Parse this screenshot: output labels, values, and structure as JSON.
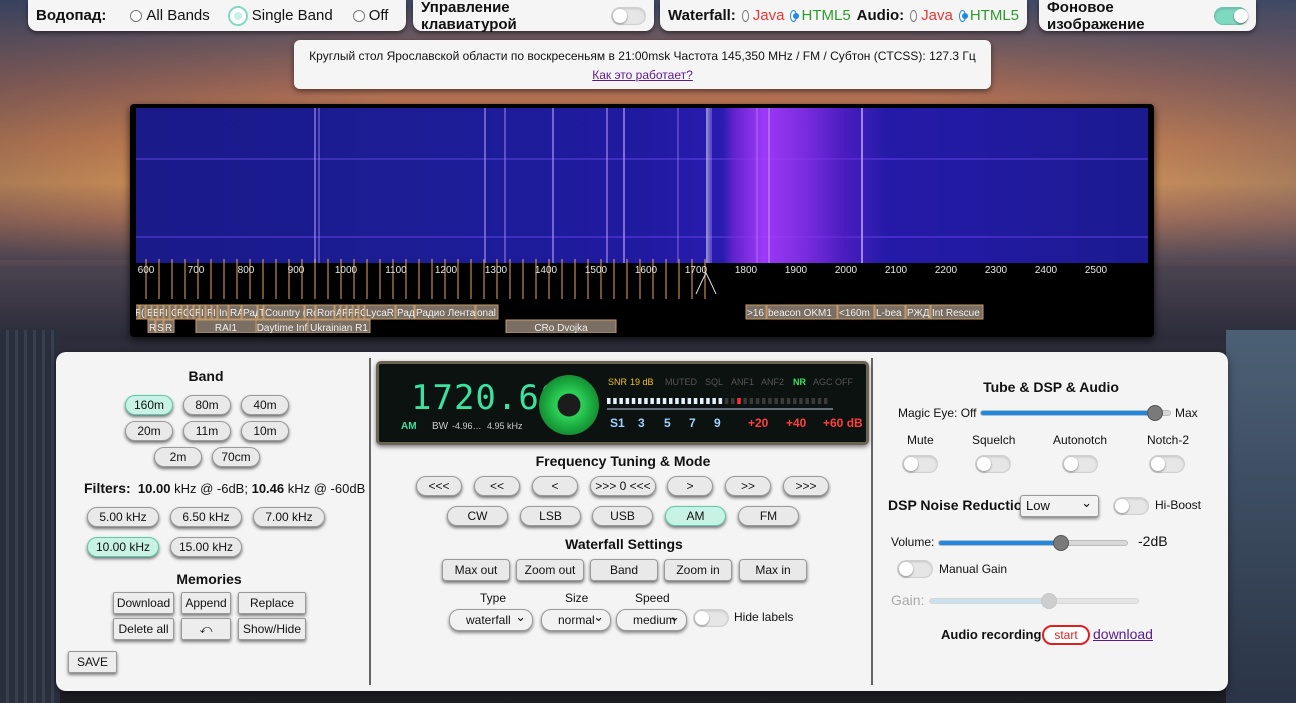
{
  "topbar": {
    "waterfall_label": "Водопад:",
    "waterfall_options": [
      "All Bands",
      "Single Band",
      "Off"
    ],
    "keyboard_label": "Управление клавиатурой",
    "wf_label": "Waterfall:",
    "wf_java": "Java",
    "wf_html5": "HTML5",
    "audio_label": "Audio:",
    "audio_java": "Java",
    "audio_html5": "HTML5",
    "bg_label": "Фоновое изображение"
  },
  "banner": {
    "text": "Круглый стол Ярославской области по воскресеньям в 21:00msk Частота 145,350 MHz / FM / Субтон (CTCSS): 127.3 Гц",
    "link": "Как это работает?"
  },
  "scale": {
    "ticks": [
      "600",
      "700",
      "800",
      "900",
      "1000",
      "1100",
      "1200",
      "1300",
      "1400",
      "1500",
      "1600",
      "1700",
      "1800",
      "1900",
      "2000",
      "2100",
      "2200",
      "2300",
      "2400",
      "2500"
    ]
  },
  "stations": {
    "row1": [
      "R",
      "(",
      "E",
      "E",
      "F",
      "I",
      "C",
      "R",
      "C",
      "C",
      "R",
      "I",
      "R",
      "I",
      "In",
      "RA",
      "Рад",
      "T",
      "Country (",
      "Ro",
      "Ron",
      "A",
      "F",
      "R",
      "R",
      "C",
      "LycaR",
      "Рад",
      "Радио Лента",
      "onal",
      ">16",
      "beacon OKM1",
      "<160m",
      "L-bea",
      "РЖД",
      "Int Rescue"
    ],
    "row2": [
      "R",
      "S",
      "R",
      "RAI1",
      "Daytime Inf",
      "Ukrainian R1",
      "CRo Dvojka"
    ]
  },
  "band": {
    "title": "Band",
    "buttons": [
      "160m",
      "80m",
      "40m",
      "20m",
      "11m",
      "10m",
      "2m",
      "70cm"
    ],
    "selected": "160m"
  },
  "filters": {
    "label": "Filters:",
    "v1": "10.00",
    "u1": " kHz @ -6dB;",
    "v2": "10.46",
    "u2": " kHz @ -60dB",
    "buttons": [
      "5.00 kHz",
      "6.50 kHz",
      "7.00 kHz",
      "10.00 kHz",
      "15.00 kHz"
    ],
    "selected": "10.00 kHz"
  },
  "memories": {
    "title": "Memories",
    "buttons": [
      "Download",
      "Append",
      "Replace",
      "Delete all",
      "⤺",
      "Show/Hide"
    ],
    "save": "SAVE"
  },
  "display": {
    "frequency": "1720.60",
    "mode": "AM",
    "bw_label": "BW",
    "bw_low": "-4.96…",
    "bw_high": "4.95 kHz",
    "snr_label": "SNR",
    "snr_value": "19 dB",
    "flags": [
      "MUTED",
      "SQL",
      "ANF1",
      "ANF2",
      "NR",
      "AGC OFF"
    ],
    "s_marks": [
      "S1",
      "3",
      "5",
      "7",
      "9"
    ],
    "db_marks": [
      "+20",
      "+40",
      "+60 dB"
    ]
  },
  "tuning": {
    "title": "Frequency Tuning & Mode",
    "steps": [
      "<<<",
      "<<",
      "<",
      ">>> 0 <<<",
      ">",
      ">>",
      ">>>"
    ],
    "modes": [
      "CW",
      "LSB",
      "USB",
      "AM",
      "FM"
    ],
    "selected_mode": "AM"
  },
  "wfsettings": {
    "title": "Waterfall Settings",
    "buttons": [
      "Max out",
      "Zoom out",
      "Band",
      "Zoom in",
      "Max in"
    ],
    "type_label": "Type",
    "type_value": "waterfall",
    "size_label": "Size",
    "size_value": "normal",
    "speed_label": "Speed",
    "speed_value": "medium",
    "hide_labels": "Hide labels"
  },
  "dsp": {
    "title": "Tube & DSP & Audio",
    "magic_off": "Magic Eye: Off",
    "magic_max": "Max",
    "magic_level": 0.92,
    "toggles": [
      "Mute",
      "Squelch",
      "Autonotch",
      "Notch-2"
    ],
    "nr_label": "DSP Noise Reduction:",
    "nr_value": "Low",
    "hiboost": "Hi-Boost",
    "volume_label": "Volume:",
    "volume_value": "-2dB",
    "volume_level": 0.65,
    "manual_gain": "Manual Gain",
    "gain_label": "Gain:",
    "gain_level": 0.57,
    "rec_label": "Audio recording:",
    "rec_start": "start",
    "rec_download": "download"
  }
}
